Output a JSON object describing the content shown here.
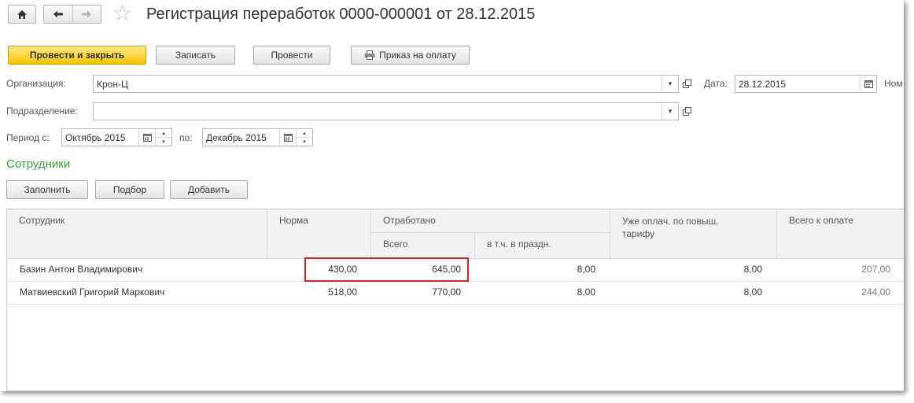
{
  "window": {
    "title": "Регистрация переработок 0000-000001 от 28.12.2015"
  },
  "toolbar": {
    "post_and_close": "Провести и закрыть",
    "save": "Записать",
    "post": "Провести",
    "payment_order": "Приказ на оплату"
  },
  "form": {
    "organization_label": "Организация:",
    "organization_value": "Крон-Ц",
    "date_label": "Дата:",
    "date_value": "28.12.2015",
    "number_label": "Ном",
    "department_label": "Подразделение:",
    "department_value": "",
    "period_from_label": "Период с:",
    "period_from_value": "Октябрь 2015",
    "period_to_label": "по:",
    "period_to_value": "Декабрь 2015"
  },
  "employees_section": {
    "title": "Сотрудники",
    "fill": "Заполнить",
    "select": "Подбор",
    "add": "Добавить"
  },
  "table": {
    "headers": {
      "employee": "Сотрудник",
      "norm": "Норма",
      "worked": "Отработано",
      "worked_total": "Всего",
      "worked_holidays": "в т.ч. в праздн.",
      "already_paid": "Уже оплач. по повыш. тарифу",
      "total_to_pay": "Всего к оплате"
    },
    "rows": [
      {
        "employee": "Базин Антон Владимирович",
        "norm": "430,00",
        "worked_total": "645,00",
        "worked_holidays": "8,00",
        "already_paid": "8,00",
        "total_to_pay": "207,00"
      },
      {
        "employee": "Матвиевский Григорий Маркович",
        "norm": "518,00",
        "worked_total": "770,00",
        "worked_holidays": "8,00",
        "already_paid": "8,00",
        "total_to_pay": "244,00"
      }
    ]
  },
  "colors": {
    "primary_button": "#f5c500",
    "section_title": "#3aa33a",
    "highlight_border": "#e02020"
  }
}
